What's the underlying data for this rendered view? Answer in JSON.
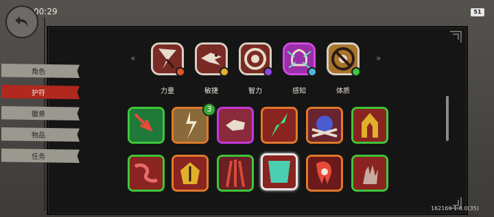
{
  "status": {
    "time": "00:29",
    "battery": "51"
  },
  "sidebar": {
    "items": [
      {
        "label": "角色",
        "active": false
      },
      {
        "label": "护符",
        "active": true
      },
      {
        "label": "徽章",
        "active": false
      },
      {
        "label": "物品",
        "active": false
      },
      {
        "label": "任务",
        "active": false
      }
    ]
  },
  "attributes": [
    {
      "label": "力量",
      "icon": "strength-icon",
      "badge_color": "#e0542a",
      "active": false
    },
    {
      "label": "敏捷",
      "icon": "agility-icon",
      "badge_color": "#e0b02a",
      "active": false
    },
    {
      "label": "智力",
      "icon": "intellect-icon",
      "badge_color": "#8a4ae0",
      "active": false
    },
    {
      "label": "感知",
      "icon": "perception-icon",
      "badge_color": "#4ab8e0",
      "active": true
    },
    {
      "label": "体质",
      "icon": "constitution-icon",
      "badge_color": "#3ec83a",
      "active": false
    }
  ],
  "skills": {
    "row1": [
      {
        "icon": "arrow-strike-icon",
        "rarity": "green"
      },
      {
        "icon": "lightning-burst-icon",
        "rarity": "orange",
        "count": "3"
      },
      {
        "icon": "fist-icon",
        "rarity": "purple"
      },
      {
        "icon": "green-slash-icon",
        "rarity": "orange"
      },
      {
        "icon": "masked-face-icon",
        "rarity": "orange"
      },
      {
        "icon": "golden-arch-icon",
        "rarity": "green"
      }
    ],
    "row2": [
      {
        "icon": "flame-tendril-icon",
        "rarity": "green"
      },
      {
        "icon": "golden-helm-icon",
        "rarity": "orange"
      },
      {
        "icon": "claw-icon",
        "rarity": "green"
      },
      {
        "icon": "teal-gate-icon",
        "rarity": "selected"
      },
      {
        "icon": "fang-icon",
        "rarity": "orange"
      },
      {
        "icon": "hand-icon",
        "rarity": "green"
      }
    ]
  },
  "version": "162166 1.0.0(35)"
}
